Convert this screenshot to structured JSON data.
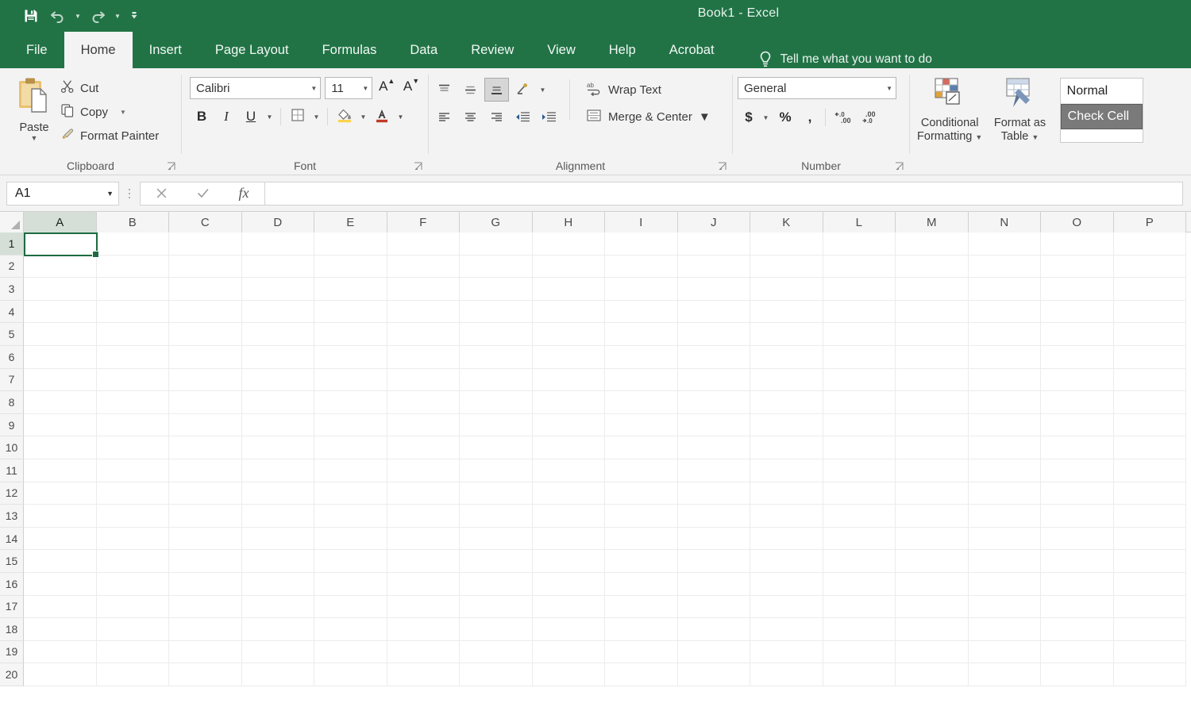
{
  "window": {
    "title": "Book1 - Excel",
    "accent_color": "#217346",
    "ribbon_bg": "#f3f3f3"
  },
  "quick_access": {
    "items": [
      {
        "name": "save",
        "icon": "save-icon",
        "label": "Save"
      },
      {
        "name": "undo",
        "icon": "undo-icon",
        "label": "Undo"
      },
      {
        "name": "redo",
        "icon": "redo-icon",
        "label": "Redo"
      },
      {
        "name": "customize",
        "icon": "chevron-down-icon",
        "label": "Customize Quick Access Toolbar"
      }
    ]
  },
  "tabs": [
    {
      "label": "File",
      "active": false
    },
    {
      "label": "Home",
      "active": true
    },
    {
      "label": "Insert",
      "active": false
    },
    {
      "label": "Page Layout",
      "active": false
    },
    {
      "label": "Formulas",
      "active": false
    },
    {
      "label": "Data",
      "active": false
    },
    {
      "label": "Review",
      "active": false
    },
    {
      "label": "View",
      "active": false
    },
    {
      "label": "Help",
      "active": false
    },
    {
      "label": "Acrobat",
      "active": false
    }
  ],
  "tell_me": {
    "label": "Tell me what you want to do",
    "icon": "lightbulb-icon"
  },
  "ribbon": {
    "clipboard": {
      "group_label": "Clipboard",
      "paste_label": "Paste",
      "cut_label": "Cut",
      "copy_label": "Copy",
      "format_painter_label": "Format Painter"
    },
    "font": {
      "group_label": "Font",
      "font_name": "Calibri",
      "font_size": "11",
      "grow_font": "A",
      "shrink_font": "A",
      "bold": "B",
      "italic": "I",
      "underline": "U",
      "fill_color": "#ffd34d",
      "font_color": "#c0392b"
    },
    "alignment": {
      "group_label": "Alignment",
      "wrap_text_label": "Wrap Text",
      "merge_center_label": "Merge & Center"
    },
    "number": {
      "group_label": "Number",
      "format": "General",
      "currency": "$",
      "percent": "%",
      "comma": ",",
      "increase_decimal": "+.0",
      "decrease_decimal": ".00"
    },
    "styles": {
      "conditional_formatting_label": "Conditional\nFormatting",
      "conditional_formatting_line1": "Conditional",
      "conditional_formatting_line2": "Formatting",
      "format_as_table_line1": "Format as",
      "format_as_table_line2": "Table",
      "gallery": [
        {
          "label": "Normal",
          "selected": false
        },
        {
          "label": "Check Cell",
          "selected": true
        }
      ],
      "selected_style_bg": "#7a7a7a"
    }
  },
  "formula_bar": {
    "name_box_value": "A1",
    "cancel_icon": "close-icon",
    "enter_icon": "check-icon",
    "function_icon": "fx-icon",
    "formula_value": "",
    "formula_placeholder": ""
  },
  "grid": {
    "columns": [
      "A",
      "B",
      "C",
      "D",
      "E",
      "F",
      "G",
      "H",
      "I",
      "J",
      "K",
      "L",
      "M",
      "N",
      "O",
      "P"
    ],
    "rows": [
      "1",
      "2",
      "3",
      "4",
      "5",
      "6",
      "7",
      "8",
      "9",
      "10",
      "11",
      "12",
      "13",
      "14",
      "15",
      "16",
      "17",
      "18",
      "19",
      "20"
    ],
    "active_cell": "A1",
    "active_column": "A",
    "active_row": "1",
    "selection_border_color": "#1e6b41",
    "cells": []
  }
}
